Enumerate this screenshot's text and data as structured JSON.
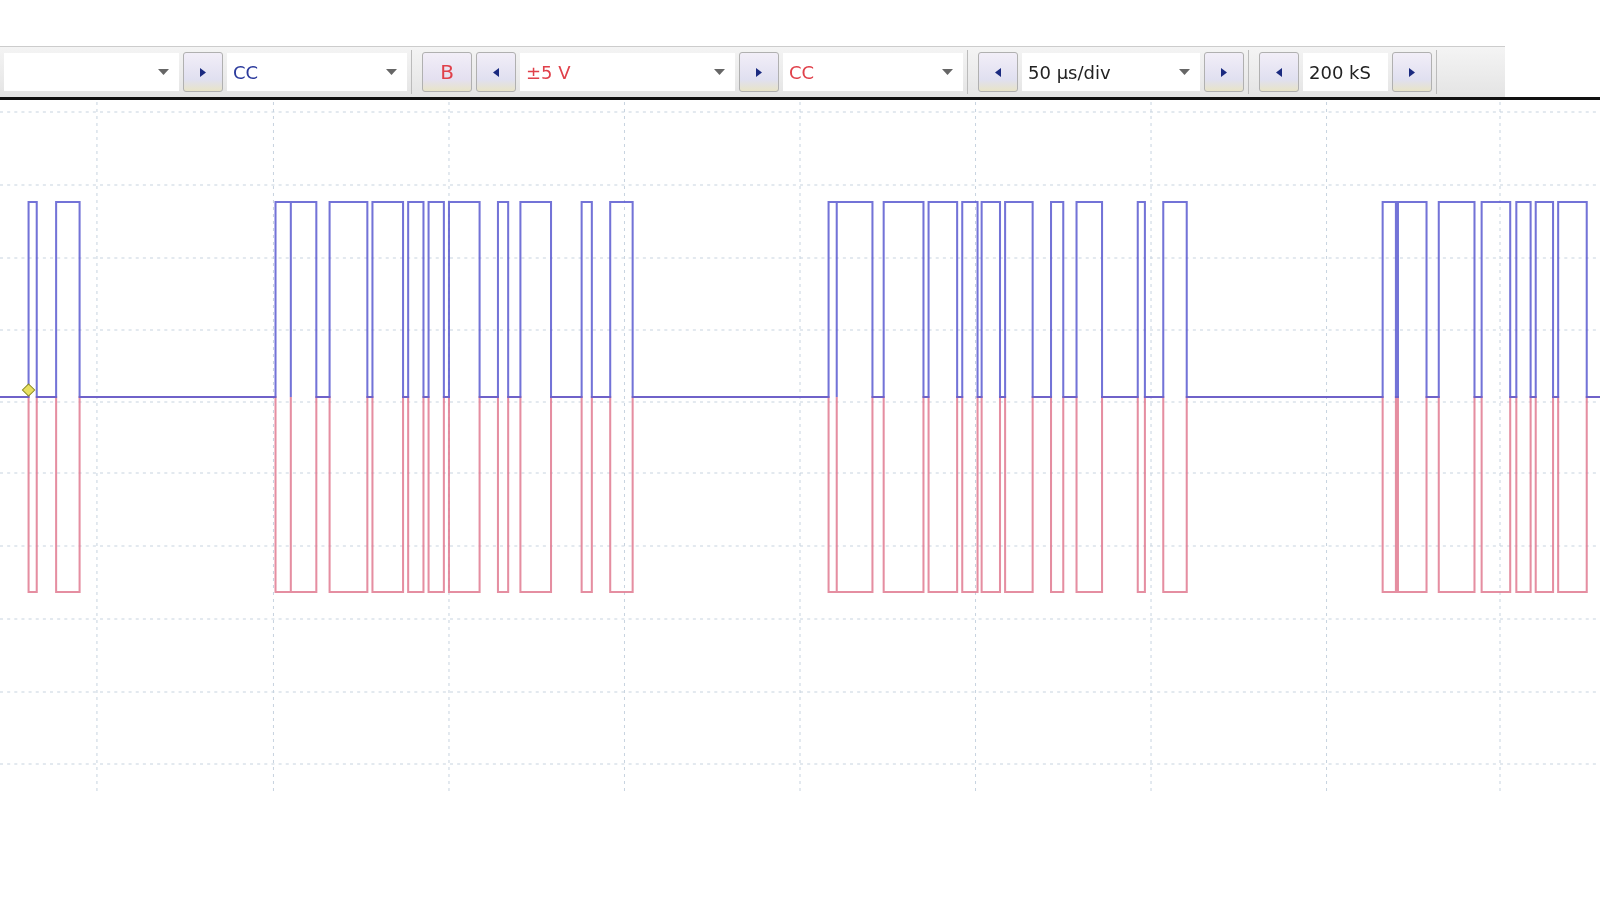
{
  "toolbar": {
    "groups": [
      {
        "controls": [
          {
            "kind": "dropdown"
          },
          {
            "kind": "next"
          },
          {
            "kind": "dropdown",
            "value": "CC",
            "color": "#2b3a9c"
          }
        ]
      },
      {
        "controls": [
          {
            "kind": "channel",
            "value": "B",
            "color": "#e0404a"
          },
          {
            "kind": "prev"
          },
          {
            "kind": "dropdown",
            "value": "±5 V",
            "color": "#e0404a"
          },
          {
            "kind": "next"
          },
          {
            "kind": "dropdown",
            "value": "CC",
            "color": "#e0404a"
          }
        ]
      },
      {
        "controls": [
          {
            "kind": "prev"
          },
          {
            "kind": "dropdown",
            "value": "50 µs/div",
            "color": "#222222"
          },
          {
            "kind": "next"
          }
        ]
      },
      {
        "controls": [
          {
            "kind": "prev"
          },
          {
            "kind": "field",
            "value": "200 kS"
          },
          {
            "kind": "next"
          }
        ]
      }
    ]
  }
}
